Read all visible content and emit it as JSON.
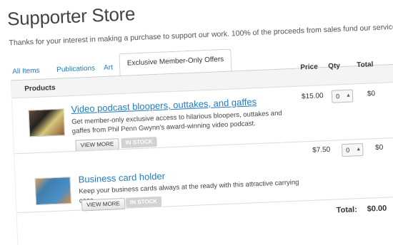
{
  "store": {
    "title": "Supporter Store",
    "subtitle": "Thanks for your interest in making a purchase to support our work. 100% of the proceeds from sales fund our services."
  },
  "tabs": [
    {
      "label": "All Items",
      "active": false
    },
    {
      "label": "Publications",
      "active": false
    },
    {
      "label": "Art",
      "active": false
    },
    {
      "label": "Exclusive Member-Only Offers",
      "active": true
    }
  ],
  "table": {
    "headers": {
      "products": "Products",
      "price": "Price",
      "qty": "Qty",
      "total": "Total"
    }
  },
  "products": [
    {
      "name": "Video podcast bloopers, outtakes, and gaffes",
      "description": "Get member-only exclusive access to hilarious bloopers, outtakes and gaffes from Phil Penn Gwynn's award-winning video podcast.",
      "view_more": "VIEW MORE",
      "stock": "IN STOCK",
      "price": "$15.00",
      "qty": "0",
      "total": "$0"
    },
    {
      "name": "Business card holder",
      "description": "Keep your business cards always at the ready with this attractive carrying case.",
      "view_more": "VIEW MORE",
      "stock": "IN STOCK",
      "price": "$7.50",
      "qty": "0",
      "total": "$0"
    }
  ],
  "summary": {
    "total_label": "Total:",
    "total_value": "$0.00"
  },
  "icons": {
    "qty_arrows": "up-down-arrows-icon"
  },
  "colors": {
    "link": "#1f7cc1",
    "badge": "#d2d2d2",
    "header_bg": "#f4f4f4"
  }
}
